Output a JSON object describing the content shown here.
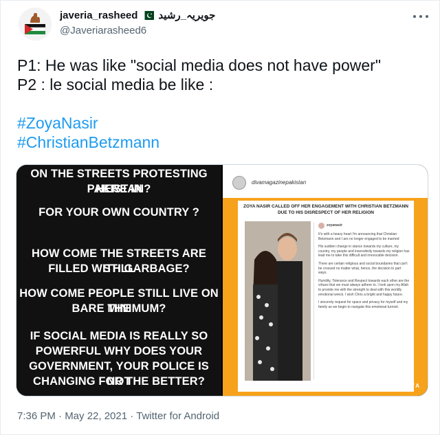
{
  "tweet": {
    "display_name": "javeria_rasheed",
    "urdu_name": "جویریہ_رشید",
    "handle": "@Javeriarasheed6",
    "text_lines": [
      "P1: He was like \"social media does not have power\"",
      "P2 : le social media be like :"
    ],
    "hashtags": [
      "#ZoyaNasir",
      "#ChristianBetzmann"
    ],
    "timestamp": "7:36 PM · May 22, 2021 · Twitter for Android"
  },
  "media": {
    "left_image_lines": [
      "ON THE STREETS PROTESTING HERE IN",
      "PAKISTAN?",
      "FOR YOUR OWN COUNTRY ?",
      "HOW COME THE STREETS ARE STILL",
      "FILLED WITH GARBAGE?",
      "HOW COME PEOPLE STILL LIVE ON THE",
      "BARE MINIMUM?",
      "IF SOCIAL MEDIA IS REALLY SO",
      "POWERFUL WHY DOES YOUR",
      "GOVERNMENT, YOUR POLICE IS NOT",
      "CHANGING FOR THE BETTER?"
    ],
    "right_image": {
      "account": "divamagazinepakistan",
      "headline": "Zoya Nasir Called Off Her Engagement With Christian Betzmann Due To His Disrespect Of Her Religion",
      "stmt_user": "zoyanasir",
      "paragraphs": [
        "It's with a heavy heart I'm announcing that Christian Betzmann and I are no longer engaged to be married",
        "His sudden change in stance towards my culture, my country, my people and insensitivity towards my religion has lead me to take this difficult and irrevocable decision.",
        "There are certain religious and social boundaries that can't be crossed no matter what, hence, the decision to part ways.",
        "Humility, Tolerance and Respect towards each other are the virtues that we must always adhere to. I look upon my Allah to provide me with the strength to deal with this worldly emotional wreck. I wish Chris a bright and happy future.",
        "I sincerely request for space and privacy for myself and my family as we begin to navigate this emotional turmoil."
      ],
      "brand": "DIVA"
    }
  },
  "colors": {
    "link": "#1d9bf0",
    "muted": "#536471",
    "orange": "#f7a21b"
  }
}
